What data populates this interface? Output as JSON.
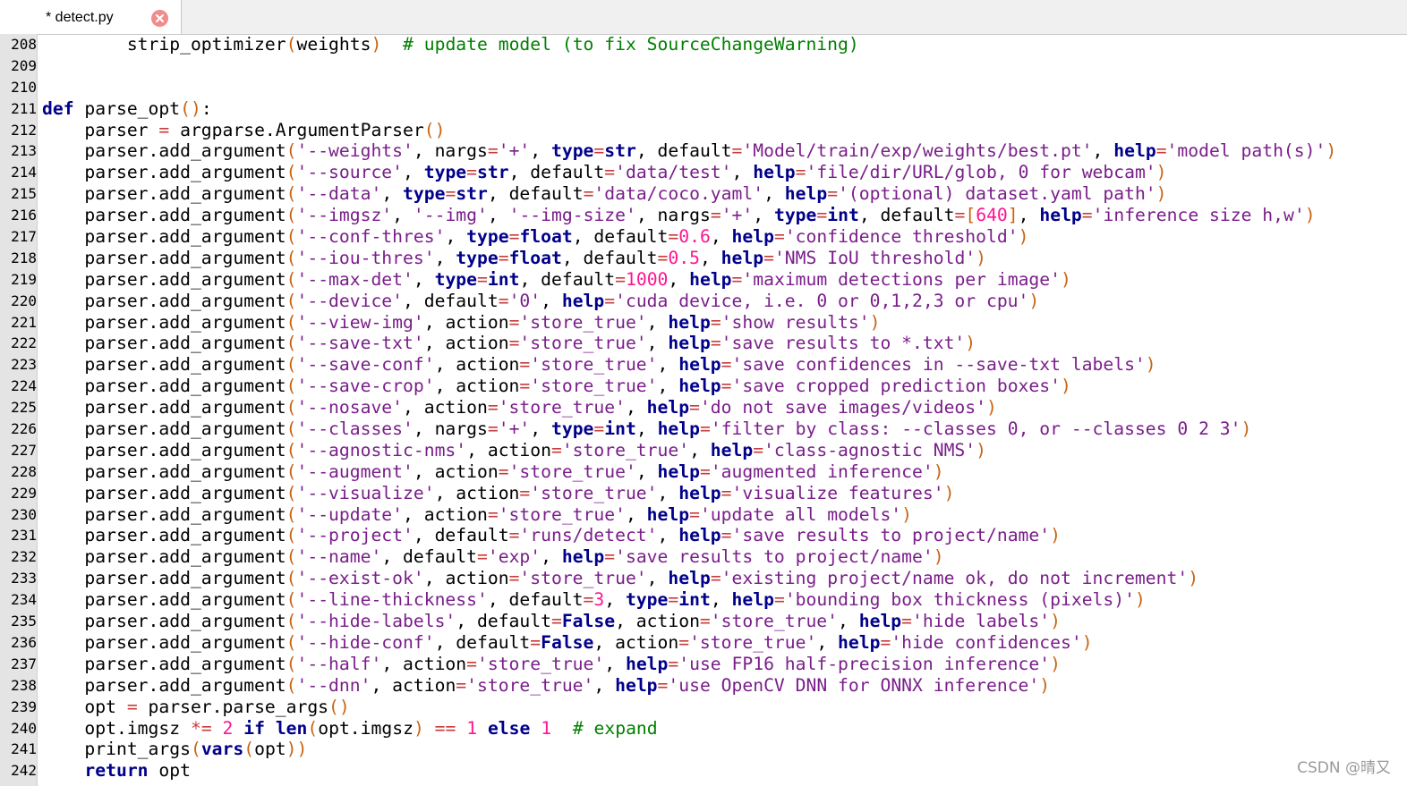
{
  "tab": {
    "title": "* detect.py"
  },
  "code": {
    "lines": [
      {
        "n": "208",
        "t": "        strip_optimizer(weights)  # update model (to fix SourceChangeWarning)"
      },
      {
        "n": "209",
        "t": ""
      },
      {
        "n": "210",
        "t": ""
      },
      {
        "n": "211",
        "t": "def parse_opt():"
      },
      {
        "n": "212",
        "t": "    parser = argparse.ArgumentParser()"
      },
      {
        "n": "213",
        "t": "    parser.add_argument('--weights', nargs='+', type=str, default='Model/train/exp/weights/best.pt', help='model path(s)')"
      },
      {
        "n": "214",
        "t": "    parser.add_argument('--source', type=str, default='data/test', help='file/dir/URL/glob, 0 for webcam')"
      },
      {
        "n": "215",
        "t": "    parser.add_argument('--data', type=str, default='data/coco.yaml', help='(optional) dataset.yaml path')"
      },
      {
        "n": "216",
        "t": "    parser.add_argument('--imgsz', '--img', '--img-size', nargs='+', type=int, default=[640], help='inference size h,w')"
      },
      {
        "n": "217",
        "t": "    parser.add_argument('--conf-thres', type=float, default=0.6, help='confidence threshold')"
      },
      {
        "n": "218",
        "t": "    parser.add_argument('--iou-thres', type=float, default=0.5, help='NMS IoU threshold')"
      },
      {
        "n": "219",
        "t": "    parser.add_argument('--max-det', type=int, default=1000, help='maximum detections per image')"
      },
      {
        "n": "220",
        "t": "    parser.add_argument('--device', default='0', help='cuda device, i.e. 0 or 0,1,2,3 or cpu')"
      },
      {
        "n": "221",
        "t": "    parser.add_argument('--view-img', action='store_true', help='show results')"
      },
      {
        "n": "222",
        "t": "    parser.add_argument('--save-txt', action='store_true', help='save results to *.txt')"
      },
      {
        "n": "223",
        "t": "    parser.add_argument('--save-conf', action='store_true', help='save confidences in --save-txt labels')"
      },
      {
        "n": "224",
        "t": "    parser.add_argument('--save-crop', action='store_true', help='save cropped prediction boxes')"
      },
      {
        "n": "225",
        "t": "    parser.add_argument('--nosave', action='store_true', help='do not save images/videos')"
      },
      {
        "n": "226",
        "t": "    parser.add_argument('--classes', nargs='+', type=int, help='filter by class: --classes 0, or --classes 0 2 3')"
      },
      {
        "n": "227",
        "t": "    parser.add_argument('--agnostic-nms', action='store_true', help='class-agnostic NMS')"
      },
      {
        "n": "228",
        "t": "    parser.add_argument('--augment', action='store_true', help='augmented inference')"
      },
      {
        "n": "229",
        "t": "    parser.add_argument('--visualize', action='store_true', help='visualize features')"
      },
      {
        "n": "230",
        "t": "    parser.add_argument('--update', action='store_true', help='update all models')"
      },
      {
        "n": "231",
        "t": "    parser.add_argument('--project', default='runs/detect', help='save results to project/name')"
      },
      {
        "n": "232",
        "t": "    parser.add_argument('--name', default='exp', help='save results to project/name')"
      },
      {
        "n": "233",
        "t": "    parser.add_argument('--exist-ok', action='store_true', help='existing project/name ok, do not increment')"
      },
      {
        "n": "234",
        "t": "    parser.add_argument('--line-thickness', default=3, type=int, help='bounding box thickness (pixels)')"
      },
      {
        "n": "235",
        "t": "    parser.add_argument('--hide-labels', default=False, action='store_true', help='hide labels')"
      },
      {
        "n": "236",
        "t": "    parser.add_argument('--hide-conf', default=False, action='store_true', help='hide confidences')"
      },
      {
        "n": "237",
        "t": "    parser.add_argument('--half', action='store_true', help='use FP16 half-precision inference')"
      },
      {
        "n": "238",
        "t": "    parser.add_argument('--dnn', action='store_true', help='use OpenCV DNN for ONNX inference')"
      },
      {
        "n": "239",
        "t": "    opt = parser.parse_args()"
      },
      {
        "n": "240",
        "t": "    opt.imgsz *= 2 if len(opt.imgsz) == 1 else 1  # expand"
      },
      {
        "n": "241",
        "t": "    print_args(vars(opt))"
      },
      {
        "n": "242",
        "t": "    return opt"
      }
    ]
  },
  "watermark": "CSDN @晴又",
  "colors": {
    "keyword": "#00008b",
    "string": "#7a1e8a",
    "number": "#ff1493",
    "operator": "#c83c3c",
    "comment": "#008000",
    "bracket": "#c86414",
    "gutter": "#e4e4e4"
  }
}
